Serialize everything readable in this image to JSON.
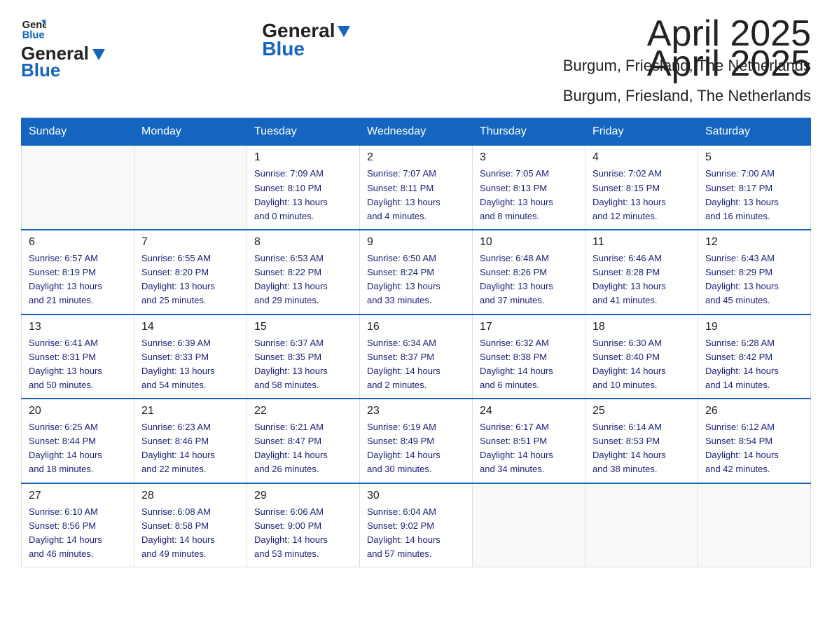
{
  "header": {
    "logo_text1": "General",
    "logo_text2": "Blue",
    "month": "April 2025",
    "location": "Burgum, Friesland, The Netherlands"
  },
  "weekdays": [
    "Sunday",
    "Monday",
    "Tuesday",
    "Wednesday",
    "Thursday",
    "Friday",
    "Saturday"
  ],
  "weeks": [
    [
      {
        "day": "",
        "info": ""
      },
      {
        "day": "",
        "info": ""
      },
      {
        "day": "1",
        "info": "Sunrise: 7:09 AM\nSunset: 8:10 PM\nDaylight: 13 hours\nand 0 minutes."
      },
      {
        "day": "2",
        "info": "Sunrise: 7:07 AM\nSunset: 8:11 PM\nDaylight: 13 hours\nand 4 minutes."
      },
      {
        "day": "3",
        "info": "Sunrise: 7:05 AM\nSunset: 8:13 PM\nDaylight: 13 hours\nand 8 minutes."
      },
      {
        "day": "4",
        "info": "Sunrise: 7:02 AM\nSunset: 8:15 PM\nDaylight: 13 hours\nand 12 minutes."
      },
      {
        "day": "5",
        "info": "Sunrise: 7:00 AM\nSunset: 8:17 PM\nDaylight: 13 hours\nand 16 minutes."
      }
    ],
    [
      {
        "day": "6",
        "info": "Sunrise: 6:57 AM\nSunset: 8:19 PM\nDaylight: 13 hours\nand 21 minutes."
      },
      {
        "day": "7",
        "info": "Sunrise: 6:55 AM\nSunset: 8:20 PM\nDaylight: 13 hours\nand 25 minutes."
      },
      {
        "day": "8",
        "info": "Sunrise: 6:53 AM\nSunset: 8:22 PM\nDaylight: 13 hours\nand 29 minutes."
      },
      {
        "day": "9",
        "info": "Sunrise: 6:50 AM\nSunset: 8:24 PM\nDaylight: 13 hours\nand 33 minutes."
      },
      {
        "day": "10",
        "info": "Sunrise: 6:48 AM\nSunset: 8:26 PM\nDaylight: 13 hours\nand 37 minutes."
      },
      {
        "day": "11",
        "info": "Sunrise: 6:46 AM\nSunset: 8:28 PM\nDaylight: 13 hours\nand 41 minutes."
      },
      {
        "day": "12",
        "info": "Sunrise: 6:43 AM\nSunset: 8:29 PM\nDaylight: 13 hours\nand 45 minutes."
      }
    ],
    [
      {
        "day": "13",
        "info": "Sunrise: 6:41 AM\nSunset: 8:31 PM\nDaylight: 13 hours\nand 50 minutes."
      },
      {
        "day": "14",
        "info": "Sunrise: 6:39 AM\nSunset: 8:33 PM\nDaylight: 13 hours\nand 54 minutes."
      },
      {
        "day": "15",
        "info": "Sunrise: 6:37 AM\nSunset: 8:35 PM\nDaylight: 13 hours\nand 58 minutes."
      },
      {
        "day": "16",
        "info": "Sunrise: 6:34 AM\nSunset: 8:37 PM\nDaylight: 14 hours\nand 2 minutes."
      },
      {
        "day": "17",
        "info": "Sunrise: 6:32 AM\nSunset: 8:38 PM\nDaylight: 14 hours\nand 6 minutes."
      },
      {
        "day": "18",
        "info": "Sunrise: 6:30 AM\nSunset: 8:40 PM\nDaylight: 14 hours\nand 10 minutes."
      },
      {
        "day": "19",
        "info": "Sunrise: 6:28 AM\nSunset: 8:42 PM\nDaylight: 14 hours\nand 14 minutes."
      }
    ],
    [
      {
        "day": "20",
        "info": "Sunrise: 6:25 AM\nSunset: 8:44 PM\nDaylight: 14 hours\nand 18 minutes."
      },
      {
        "day": "21",
        "info": "Sunrise: 6:23 AM\nSunset: 8:46 PM\nDaylight: 14 hours\nand 22 minutes."
      },
      {
        "day": "22",
        "info": "Sunrise: 6:21 AM\nSunset: 8:47 PM\nDaylight: 14 hours\nand 26 minutes."
      },
      {
        "day": "23",
        "info": "Sunrise: 6:19 AM\nSunset: 8:49 PM\nDaylight: 14 hours\nand 30 minutes."
      },
      {
        "day": "24",
        "info": "Sunrise: 6:17 AM\nSunset: 8:51 PM\nDaylight: 14 hours\nand 34 minutes."
      },
      {
        "day": "25",
        "info": "Sunrise: 6:14 AM\nSunset: 8:53 PM\nDaylight: 14 hours\nand 38 minutes."
      },
      {
        "day": "26",
        "info": "Sunrise: 6:12 AM\nSunset: 8:54 PM\nDaylight: 14 hours\nand 42 minutes."
      }
    ],
    [
      {
        "day": "27",
        "info": "Sunrise: 6:10 AM\nSunset: 8:56 PM\nDaylight: 14 hours\nand 46 minutes."
      },
      {
        "day": "28",
        "info": "Sunrise: 6:08 AM\nSunset: 8:58 PM\nDaylight: 14 hours\nand 49 minutes."
      },
      {
        "day": "29",
        "info": "Sunrise: 6:06 AM\nSunset: 9:00 PM\nDaylight: 14 hours\nand 53 minutes."
      },
      {
        "day": "30",
        "info": "Sunrise: 6:04 AM\nSunset: 9:02 PM\nDaylight: 14 hours\nand 57 minutes."
      },
      {
        "day": "",
        "info": ""
      },
      {
        "day": "",
        "info": ""
      },
      {
        "day": "",
        "info": ""
      }
    ]
  ],
  "colors": {
    "header_bg": "#1565c0",
    "header_text": "#ffffff",
    "accent": "#1a237e"
  }
}
